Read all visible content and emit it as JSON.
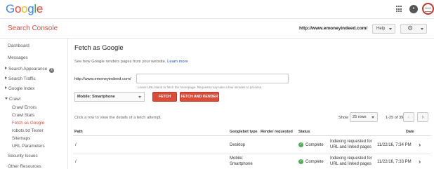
{
  "topbar": {
    "logo_letters": [
      {
        "ch": "G",
        "color": "#4285f4"
      },
      {
        "ch": "o",
        "color": "#ea4335"
      },
      {
        "ch": "o",
        "color": "#fbbc05"
      },
      {
        "ch": "g",
        "color": "#4285f4"
      },
      {
        "ch": "l",
        "color": "#34a853"
      },
      {
        "ch": "e",
        "color": "#ea4335"
      }
    ],
    "apps_icon": "apps-grid-icon",
    "notifications_icon": "notifications-icon",
    "avatar_icon": "account-avatar-icon"
  },
  "header": {
    "product_name": "Search Console",
    "site_url": "http://www.emoneyindeed.com/",
    "help_label": "Help",
    "settings_icon": "gear-icon"
  },
  "sidebar": {
    "items": [
      {
        "label": "Dashboard"
      },
      {
        "label": "Messages"
      },
      {
        "label": "Search Appearance"
      },
      {
        "label": "Search Traffic"
      },
      {
        "label": "Google Index"
      },
      {
        "label": "Crawl"
      },
      {
        "label": "Crawl Errors"
      },
      {
        "label": "Crawl Stats"
      },
      {
        "label": "Fetch as Google"
      },
      {
        "label": "robots.txt Tester"
      },
      {
        "label": "Sitemaps"
      },
      {
        "label": "URL Parameters"
      },
      {
        "label": "Security Issues"
      },
      {
        "label": "Other Resources"
      }
    ]
  },
  "main": {
    "title": "Fetch as Google",
    "description": "See how Google renders pages from your website.",
    "learn_more": "Learn more",
    "url_prefix": "http://www.emoneyindeed.com/",
    "url_value": "",
    "url_hint": "Leave URL blank to fetch the homepage. Requests may take a few minutes to process.",
    "device_selected": "Mobile: Smartphone",
    "fetch_label": "FETCH",
    "fetch_render_label": "FETCH AND RENDER",
    "row_hint": "Click a row to view the details of a fetch attempt.",
    "show_label": "Show",
    "rows_selected": "25 rows",
    "page_count": "1-25 of 39",
    "prev_icon": "chevron-left-icon",
    "next_icon": "chevron-right-icon"
  },
  "table": {
    "headers": {
      "path": "Path",
      "googlebot_type": "Googlebot type",
      "render_requested": "Render requested",
      "status": "Status",
      "date": "Date"
    },
    "rows": [
      {
        "path": "/",
        "googlebot_type": "Desktop",
        "status": "Complete",
        "status_detail_1": "Indexing requested for",
        "status_detail_2": "URL and linked pages",
        "date": "11/22/16, 7:34 PM"
      },
      {
        "path": "/",
        "googlebot_type_1": "Mobile:",
        "googlebot_type_2": "Smartphone",
        "status": "Complete",
        "status_detail_1": "Indexing requested for",
        "status_detail_2": "URL and linked pages",
        "date": "11/22/16, 7:33 PM"
      }
    ]
  },
  "colors": {
    "brand_red": "#dd4b39",
    "link_blue": "#1155cc",
    "status_green": "#4caf50"
  }
}
